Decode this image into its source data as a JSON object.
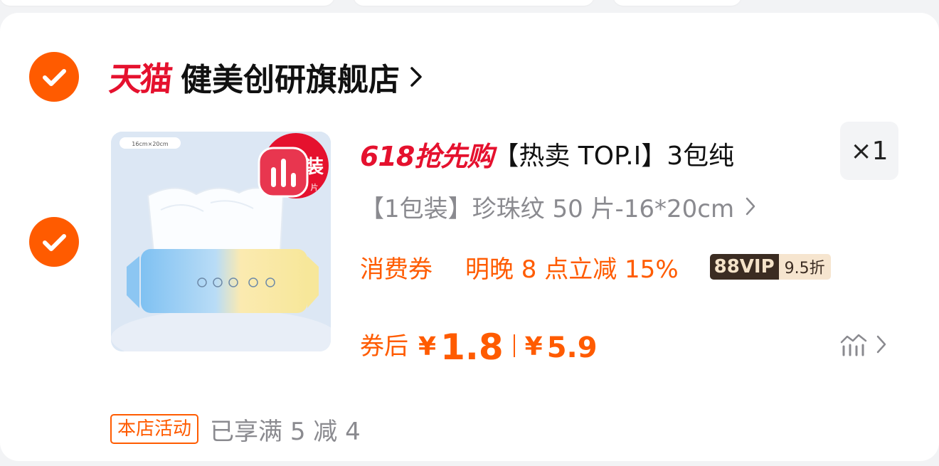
{
  "colors": {
    "accent": "#ff5b00",
    "tmall_red": "#e5112e",
    "text_primary": "#111111",
    "text_secondary": "#8a8a8f",
    "vip_dark": "#3b2c22",
    "vip_light": "#f6e5cf"
  },
  "store": {
    "brand_logo": "天猫",
    "name": "健美创研旗舰店",
    "selected": true,
    "chevron_icon": "chevron-right-icon"
  },
  "item": {
    "selected": true,
    "image_label": "16cm×20cm",
    "image_badge_text": "装",
    "image_badge_sub": "片",
    "promo_logo": "618抢先购",
    "title": "【热卖 TOP.I】3包纯",
    "quantity": "×1",
    "sku": "【1包装】珍珠纹 50 片-16*20cm",
    "coupon_label": "消费券",
    "coupon_text": "明晚 8 点立减 15%",
    "vip_left": "88VIP",
    "vip_right": "9.5折",
    "after_coupon_label": "券后",
    "currency": "¥",
    "after_coupon_price": "1.8",
    "original_price": "5.9",
    "trend_icon": "price-trend-icon"
  },
  "activity": {
    "tag": "本店活动",
    "text": "已享满 5 减 4"
  }
}
